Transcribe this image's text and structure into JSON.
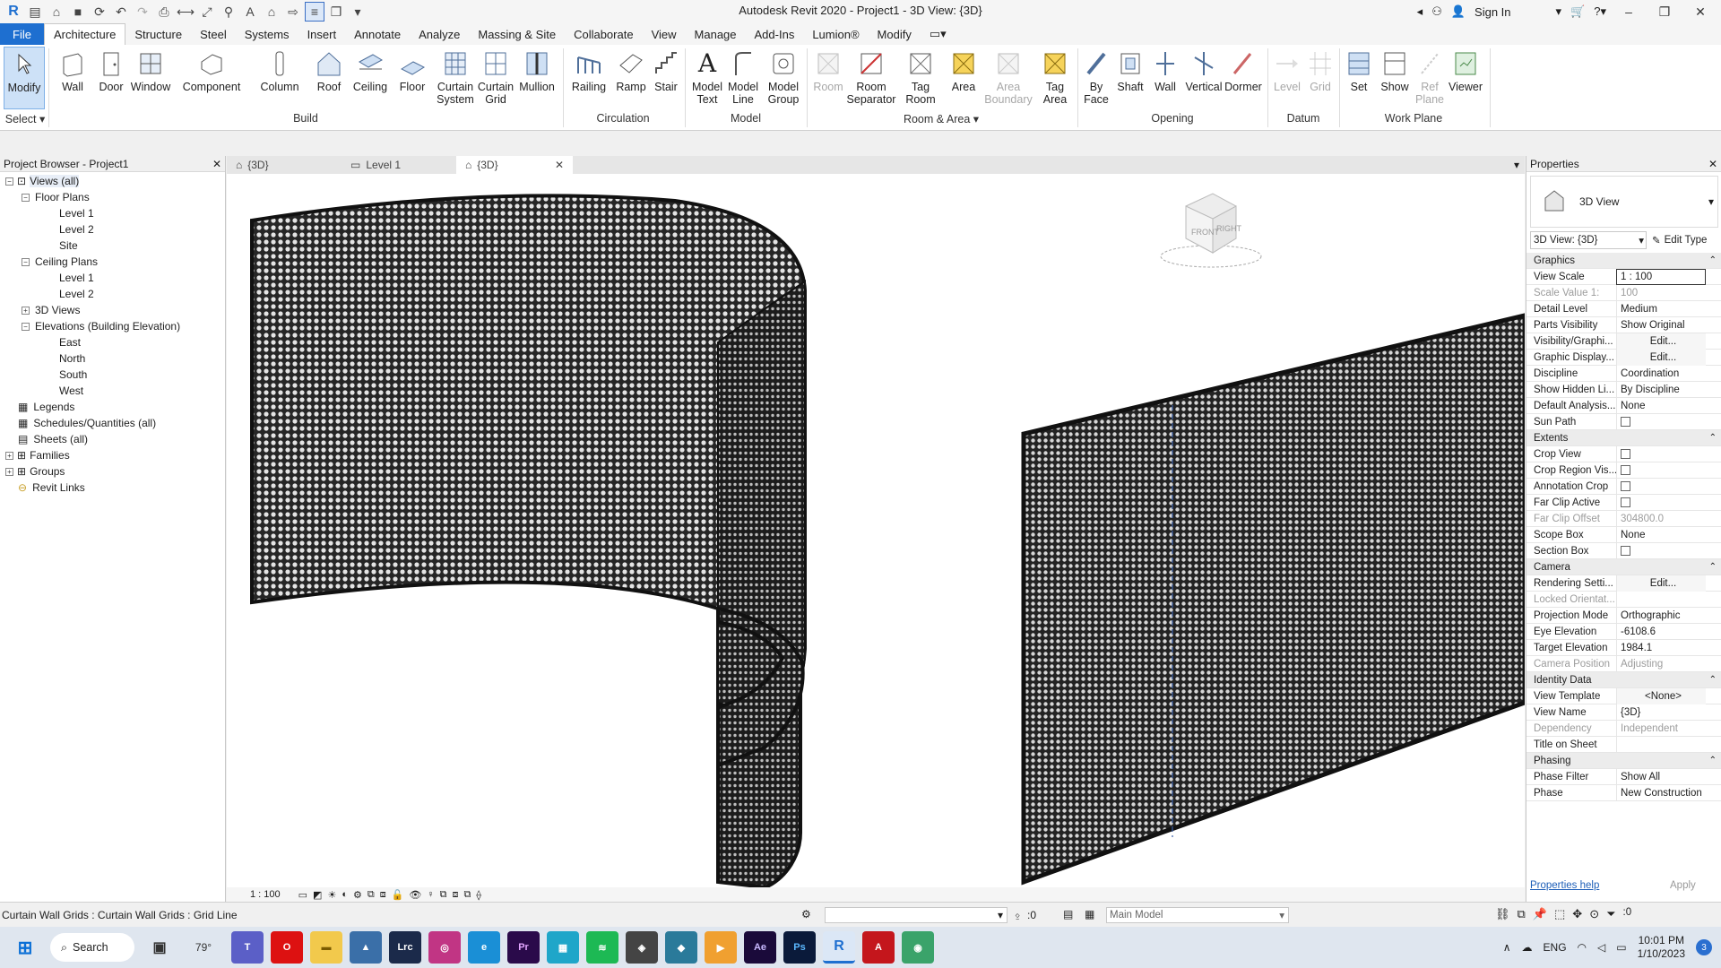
{
  "app": {
    "title": "Autodesk Revit 2020 - Project1 - 3D View: {3D}",
    "sign_in": "Sign In"
  },
  "tabs": [
    "File",
    "Architecture",
    "Structure",
    "Steel",
    "Systems",
    "Insert",
    "Annotate",
    "Analyze",
    "Massing & Site",
    "Collaborate",
    "View",
    "Manage",
    "Add-Ins",
    "Lumion®",
    "Modify"
  ],
  "ribbon": {
    "buttons": [
      {
        "l1": "Modify",
        "l2": ""
      },
      {
        "l1": "Wall",
        "l2": ""
      },
      {
        "l1": "Door",
        "l2": ""
      },
      {
        "l1": "Window",
        "l2": ""
      },
      {
        "l1": "Component",
        "l2": ""
      },
      {
        "l1": "Column",
        "l2": ""
      },
      {
        "l1": "Roof",
        "l2": ""
      },
      {
        "l1": "Ceiling",
        "l2": ""
      },
      {
        "l1": "Floor",
        "l2": ""
      },
      {
        "l1": "Curtain",
        "l2": "System"
      },
      {
        "l1": "Curtain",
        "l2": "Grid"
      },
      {
        "l1": "Mullion",
        "l2": ""
      },
      {
        "l1": "Railing",
        "l2": ""
      },
      {
        "l1": "Ramp",
        "l2": ""
      },
      {
        "l1": "Stair",
        "l2": ""
      },
      {
        "l1": "Model",
        "l2": "Text"
      },
      {
        "l1": "Model",
        "l2": "Line"
      },
      {
        "l1": "Model",
        "l2": "Group"
      },
      {
        "l1": "Room",
        "l2": ""
      },
      {
        "l1": "Room",
        "l2": "Separator"
      },
      {
        "l1": "Tag",
        "l2": "Room"
      },
      {
        "l1": "Area",
        "l2": ""
      },
      {
        "l1": "Area",
        "l2": "Boundary"
      },
      {
        "l1": "Tag",
        "l2": "Area"
      },
      {
        "l1": "By",
        "l2": "Face"
      },
      {
        "l1": "Shaft",
        "l2": ""
      },
      {
        "l1": "Wall",
        "l2": ""
      },
      {
        "l1": "Vertical",
        "l2": ""
      },
      {
        "l1": "Dormer",
        "l2": ""
      },
      {
        "l1": "Level",
        "l2": ""
      },
      {
        "l1": "Grid",
        "l2": ""
      },
      {
        "l1": "Set",
        "l2": ""
      },
      {
        "l1": "Show",
        "l2": ""
      },
      {
        "l1": "Ref",
        "l2": "Plane"
      },
      {
        "l1": "Viewer",
        "l2": ""
      }
    ],
    "groups": [
      "Select",
      "Build",
      "Circulation",
      "Model",
      "Room & Area",
      "Opening",
      "Datum",
      "Work Plane"
    ]
  },
  "project_browser": {
    "title": "Project Browser - Project1",
    "items": [
      "Views (all)",
      "Floor Plans",
      "Level 1",
      "Level 2",
      "Site",
      "Ceiling Plans",
      "Level 1",
      "Level 2",
      "3D Views",
      "Elevations (Building Elevation)",
      "East",
      "North",
      "South",
      "West",
      "Legends",
      "Schedules/Quantities (all)",
      "Sheets (all)",
      "Families",
      "Groups",
      "Revit Links"
    ]
  },
  "view_tabs": [
    "{3D}",
    "Level 1",
    "{3D}"
  ],
  "viewcube": {
    "front": "FRONT",
    "right": "RIGHT"
  },
  "view_control": {
    "scale": "1 : 100"
  },
  "properties": {
    "title": "Properties",
    "type_name": "3D View",
    "selector": "3D View: {3D}",
    "edit_type": "Edit Type",
    "rows": [
      {
        "k": "Graphics",
        "v": "",
        "sec": true
      },
      {
        "k": "View Scale",
        "v": "1 : 100"
      },
      {
        "k": "Scale Value    1:",
        "v": "100",
        "dim": true
      },
      {
        "k": "Detail Level",
        "v": "Medium"
      },
      {
        "k": "Parts Visibility",
        "v": "Show Original"
      },
      {
        "k": "Visibility/Graphi...",
        "v": "Edit..."
      },
      {
        "k": "Graphic Display...",
        "v": "Edit..."
      },
      {
        "k": "Discipline",
        "v": "Coordination"
      },
      {
        "k": "Show Hidden Li...",
        "v": "By Discipline"
      },
      {
        "k": "Default Analysis...",
        "v": "None"
      },
      {
        "k": "Sun Path",
        "v": "",
        "cb": true
      },
      {
        "k": "Extents",
        "v": "",
        "sec": true
      },
      {
        "k": "Crop View",
        "v": "",
        "cb": true
      },
      {
        "k": "Crop Region Vis...",
        "v": "",
        "cb": true
      },
      {
        "k": "Annotation Crop",
        "v": "",
        "cb": true
      },
      {
        "k": "Far Clip Active",
        "v": "",
        "cb": true
      },
      {
        "k": "Far Clip Offset",
        "v": "304800.0",
        "dim": true
      },
      {
        "k": "Scope Box",
        "v": "None"
      },
      {
        "k": "Section Box",
        "v": "",
        "cb": true
      },
      {
        "k": "Camera",
        "v": "",
        "sec": true
      },
      {
        "k": "Rendering Setti...",
        "v": "Edit..."
      },
      {
        "k": "Locked Orientat...",
        "v": "",
        "dim": true
      },
      {
        "k": "Projection Mode",
        "v": "Orthographic"
      },
      {
        "k": "Eye Elevation",
        "v": "-6108.6"
      },
      {
        "k": "Target Elevation",
        "v": "1984.1"
      },
      {
        "k": "Camera Position",
        "v": "Adjusting",
        "dim": true
      },
      {
        "k": "Identity Data",
        "v": "",
        "sec": true
      },
      {
        "k": "View Template",
        "v": "<None>"
      },
      {
        "k": "View Name",
        "v": "{3D}"
      },
      {
        "k": "Dependency",
        "v": "Independent",
        "dim": true
      },
      {
        "k": "Title on Sheet",
        "v": ""
      },
      {
        "k": "Phasing",
        "v": "",
        "sec": true
      },
      {
        "k": "Phase Filter",
        "v": "Show All"
      },
      {
        "k": "Phase",
        "v": "New Construction"
      }
    ],
    "help": "Properties help",
    "apply": "Apply"
  },
  "status": {
    "text": "Curtain Wall Grids : Curtain Wall Grids : Grid Line",
    "model": "Main Model",
    "sel_count": ":0",
    "filter_count": ":0"
  },
  "taskbar": {
    "search": "Search",
    "weather": "79°",
    "lang": "ENG",
    "time": "10:01 PM",
    "date": "1/10/2023",
    "notif": "3"
  }
}
